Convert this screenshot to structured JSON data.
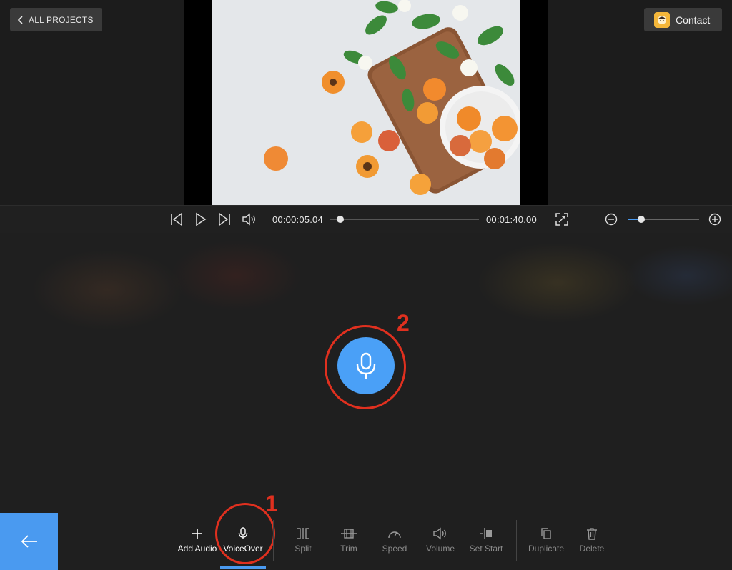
{
  "header": {
    "back_label": "ALL PROJECTS",
    "contact_label": "Contact"
  },
  "player": {
    "current_time": "00:00:05.04",
    "total_time": "00:01:40.00",
    "progress": 0.05,
    "zoom_level": 0.2
  },
  "annotations": {
    "marker1": "1",
    "marker2": "2"
  },
  "toolbar": {
    "items": [
      {
        "label": "Add Audio",
        "icon": "plus-icon",
        "state": "active"
      },
      {
        "label": "VoiceOver",
        "icon": "microphone-icon",
        "state": "selected"
      },
      {
        "label": "Split",
        "icon": "split-icon",
        "state": "disabled"
      },
      {
        "label": "Trim",
        "icon": "trim-icon",
        "state": "disabled"
      },
      {
        "label": "Speed",
        "icon": "speedometer-icon",
        "state": "disabled"
      },
      {
        "label": "Volume",
        "icon": "volume-icon",
        "state": "disabled"
      },
      {
        "label": "Set Start",
        "icon": "set-start-icon",
        "state": "disabled"
      },
      {
        "label": "Duplicate",
        "icon": "duplicate-icon",
        "state": "disabled"
      },
      {
        "label": "Delete",
        "icon": "trash-icon",
        "state": "disabled"
      }
    ]
  },
  "colors": {
    "accent": "#4a9af0",
    "annotation": "#e0301f",
    "background": "#1f1f1f"
  }
}
